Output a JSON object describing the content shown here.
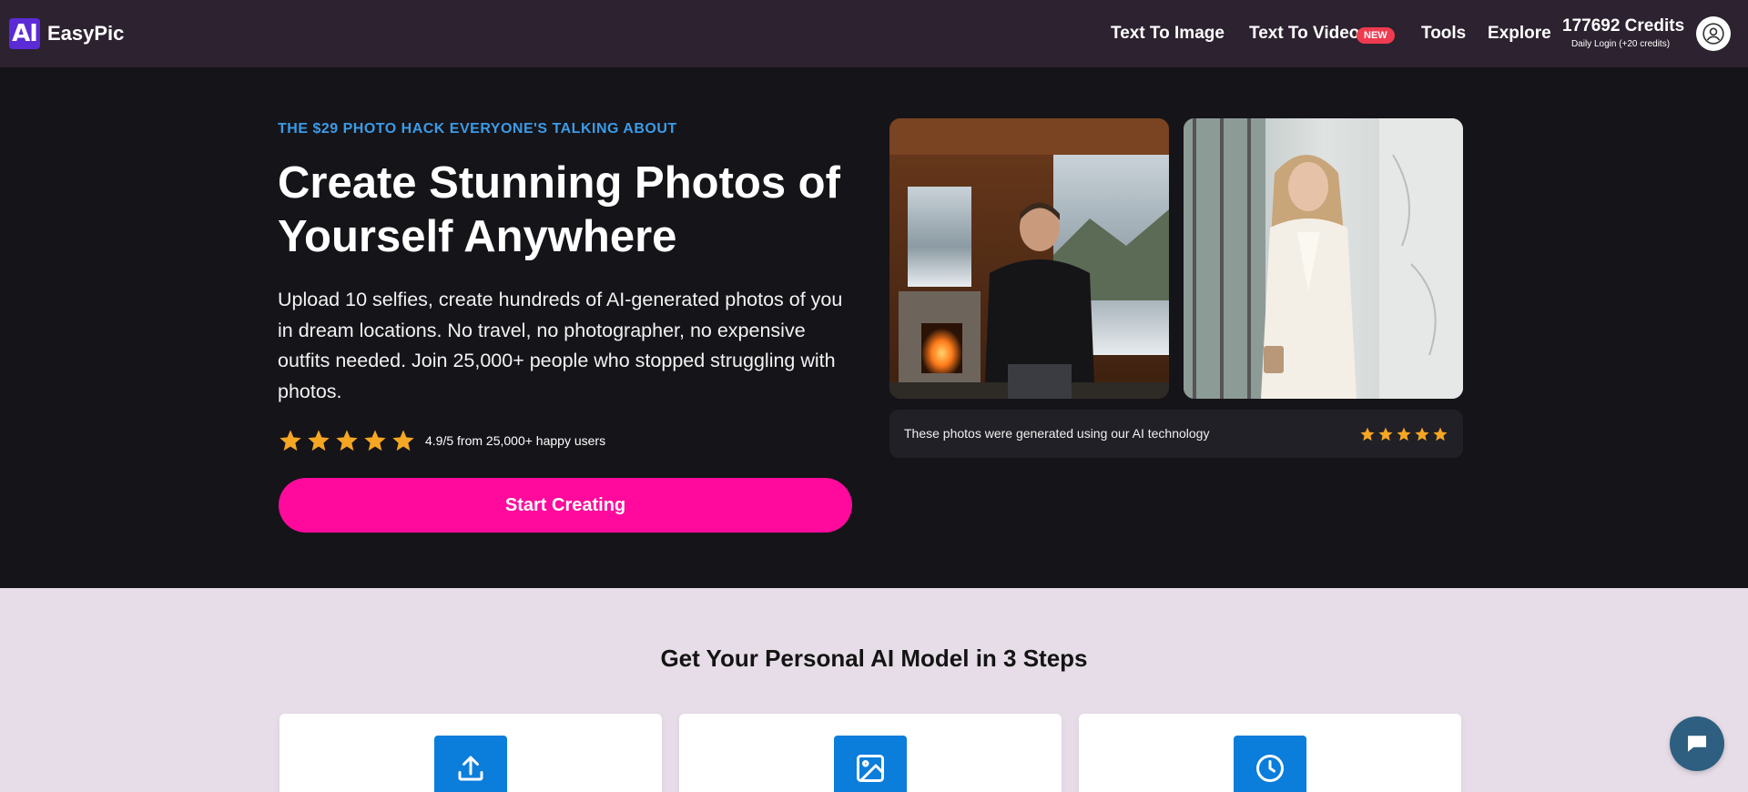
{
  "nav": {
    "logo_mark": "AI",
    "logo_text": "EasyPic",
    "links": {
      "text_to_image": "Text To Image",
      "text_to_video": "Text To Video",
      "new_badge": "NEW",
      "tools": "Tools",
      "explore": "Explore"
    },
    "credits": "177692 Credits",
    "credits_sub": "Daily Login (+20 credits)",
    "avatar_icon": "user-circle-icon"
  },
  "hero": {
    "kicker": "THE $29 PHOTO HACK EVERYONE'S TALKING ABOUT",
    "title": "Create Stunning Photos of Yourself Anywhere",
    "description": "Upload 10 selfies, create hundreds of AI-generated photos of you in dream locations. No travel, no photographer, no expensive outfits needed. Join 25,000+ people who stopped struggling with photos.",
    "rating": 5,
    "rating_text": "4.9/5 from 25,000+ happy users",
    "cta": "Start Creating",
    "caption": "These photos were generated using our AI technology",
    "caption_rating": 5
  },
  "steps": {
    "title": "Get Your Personal AI Model in 3 Steps",
    "cards": [
      {
        "icon": "upload-icon"
      },
      {
        "icon": "image-icon"
      },
      {
        "icon": "clock-icon"
      }
    ]
  },
  "chat_icon": "chat-icon",
  "colors": {
    "nav_bg": "#2d2230",
    "hero_bg": "#151419",
    "accent_blue": "#3b9be6",
    "cta_pink": "#ff0a9c",
    "star": "#f5a623",
    "section_bg": "#e7dde8",
    "step_icon_bg": "#0b7ddb"
  }
}
